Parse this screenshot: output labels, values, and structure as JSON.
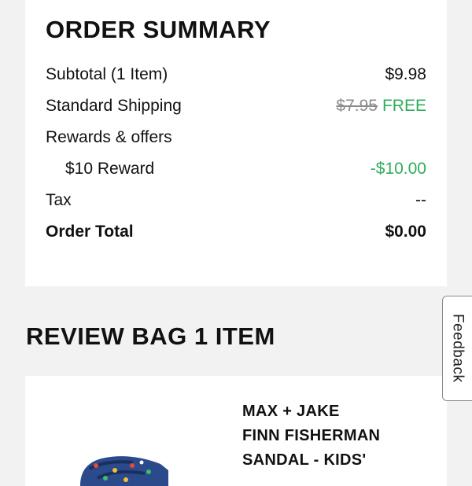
{
  "order_summary": {
    "title": "ORDER SUMMARY",
    "subtotal_label": "Subtotal (1 Item)",
    "subtotal_value": "$9.98",
    "shipping_label": "Standard Shipping",
    "shipping_original": "$7.95",
    "shipping_value": "FREE",
    "rewards_label": "Rewards & offers",
    "reward_label": "$10 Reward",
    "reward_value": "-$10.00",
    "tax_label": "Tax",
    "tax_value": "--",
    "total_label": "Order Total",
    "total_value": "$0.00"
  },
  "review_bag": {
    "title": "REVIEW BAG 1 ITEM",
    "items": [
      {
        "name_lines": [
          "MAX + JAKE",
          "FINN FISHERMAN",
          "SANDAL - KIDS'"
        ],
        "image_icon": "sandal-image"
      }
    ]
  },
  "feedback": {
    "label": "Feedback"
  },
  "colors": {
    "discount_green": "#2fad5b",
    "strike_gray": "#8c8c8c",
    "page_background": "#f2f2f2"
  }
}
